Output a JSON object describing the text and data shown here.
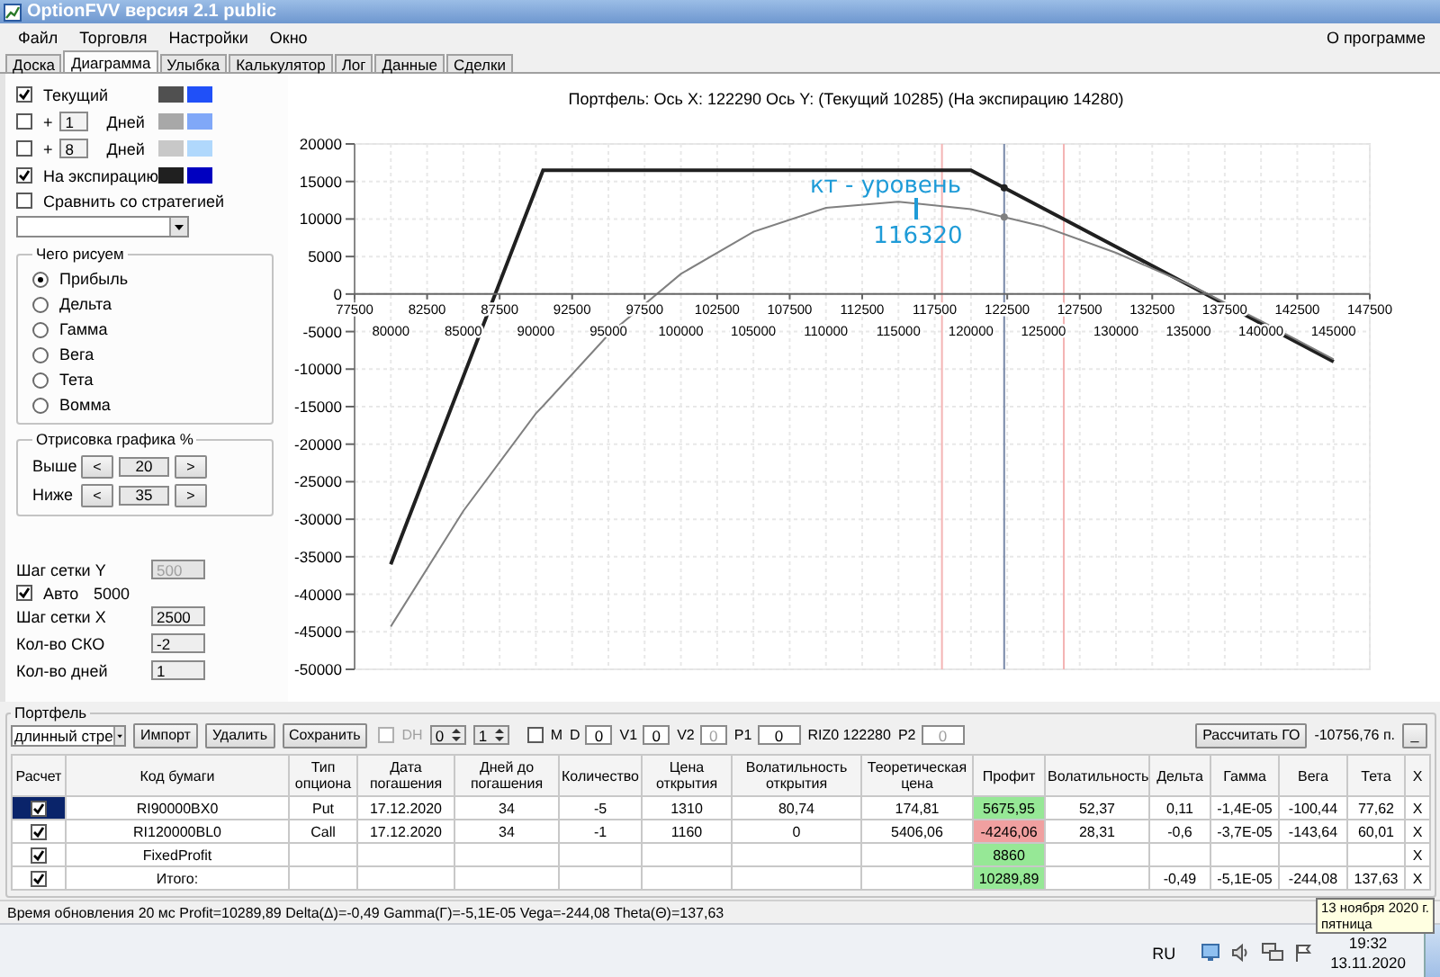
{
  "window": {
    "title": "OptionFVV версия 2.1 public"
  },
  "menu": [
    "Файл",
    "Торговля",
    "Настройки",
    "Окно"
  ],
  "menu_right": "О программе",
  "tabs": [
    {
      "label": "Доска",
      "selected": false
    },
    {
      "label": "Диаграмма",
      "selected": true
    },
    {
      "label": "Улыбка",
      "selected": false
    },
    {
      "label": "Калькулятор",
      "selected": false
    },
    {
      "label": "Лог",
      "selected": false
    },
    {
      "label": "Данные",
      "selected": false
    },
    {
      "label": "Сделки",
      "selected": false
    }
  ],
  "curves": [
    {
      "kind": "named",
      "label": "Текущий",
      "checked": true,
      "swatches": [
        {
          "color": "#505050"
        },
        {
          "color": "#2050f8"
        }
      ]
    },
    {
      "kind": "days",
      "prefix": "+",
      "value": "1",
      "unit": "Дней",
      "checked": false,
      "swatches": [
        {
          "color": "#a8a8a8"
        },
        {
          "color": "#80a8f8"
        }
      ]
    },
    {
      "kind": "days",
      "prefix": "+",
      "value": "8",
      "unit": "Дней",
      "checked": false,
      "swatches": [
        {
          "color": "#c8c8c8"
        },
        {
          "color": "#b0d8fc"
        }
      ]
    },
    {
      "kind": "named",
      "label": "На экспирацию",
      "checked": true,
      "swatches": [
        {
          "color": "#202020"
        },
        {
          "color": "#0000c0"
        }
      ]
    }
  ],
  "compare": {
    "label": "Сравнить со стратегией",
    "checked": false
  },
  "plot_kind": {
    "title": "Чего рисуем",
    "options": [
      {
        "label": "Прибыль",
        "selected": true
      },
      {
        "label": "Дельта",
        "selected": false
      },
      {
        "label": "Гамма",
        "selected": false
      },
      {
        "label": "Вега",
        "selected": false
      },
      {
        "label": "Тета",
        "selected": false
      },
      {
        "label": "Вомма",
        "selected": false
      }
    ]
  },
  "range": {
    "title": "Отрисовка графика %",
    "rows": [
      {
        "label": "Выше",
        "dec": "<",
        "value": "20",
        "inc": ">"
      },
      {
        "label": "Ниже",
        "dec": "<",
        "value": "35",
        "inc": ">"
      }
    ]
  },
  "grid": [
    {
      "kind": "field",
      "label": "Шаг сетки Y",
      "value": "500",
      "disabled": true
    },
    {
      "kind": "check",
      "label": "Авто",
      "checked": true,
      "value": "5000"
    },
    {
      "kind": "field",
      "label": "Шаг сетки X",
      "value": "2500",
      "disabled": false
    },
    {
      "kind": "field",
      "label": "Кол-во СКО",
      "value": "-2",
      "disabled": false
    },
    {
      "kind": "field",
      "label": "Кол-во дней",
      "value": "1",
      "disabled": false
    }
  ],
  "chart": {
    "title": "Портфель:  Ось X:  122290  Ось Y:   (Текущий  10285)   (На экспирацию  14280)",
    "x_labels_lower": [
      "80000",
      "85000",
      "90000",
      "95000",
      "100000",
      "105000",
      "110000",
      "115000",
      "120000",
      "125000",
      "130000",
      "135000",
      "140000",
      "145000"
    ],
    "chart_data": {
      "type": "line",
      "x": [
        80000,
        85000,
        90000,
        90500,
        95000,
        100000,
        105000,
        110000,
        115000,
        120000,
        125000,
        130000,
        135000,
        140000,
        145000
      ],
      "series": [
        {
          "color": "#202020",
          "values": [
            -36000,
            -11000,
            14000,
            16500,
            16500,
            16500,
            16500,
            16500,
            16500,
            16500,
            11400,
            6300,
            1200,
            -3900,
            -9000
          ]
        },
        {
          "color": "#808080",
          "values": [
            -44300,
            -28900,
            -15900,
            -14900,
            -5400,
            2700,
            8300,
            11500,
            12300,
            11300,
            9000,
            5500,
            1300,
            -3600,
            -8700
          ]
        }
      ],
      "xlim": [
        77500,
        147500
      ],
      "ylim": [
        -50000,
        20000
      ],
      "xticks": [
        77500,
        82500,
        87500,
        92500,
        97500,
        102500,
        107500,
        112500,
        117500,
        122500,
        127500,
        132500,
        137500,
        142500,
        147500
      ],
      "yticks": [
        -50000,
        -45000,
        -40000,
        -35000,
        -30000,
        -25000,
        -20000,
        -15000,
        -10000,
        -5000,
        0,
        5000,
        10000,
        15000,
        20000
      ],
      "grid": true,
      "ref_lines": [
        {
          "axis": "x",
          "value": 118000,
          "color": "#f4b4b4"
        },
        {
          "axis": "x",
          "value": 126400,
          "color": "#f4b4b4"
        },
        {
          "axis": "x",
          "value": 122290,
          "color": "#7888a8"
        }
      ],
      "annotations": [
        "кт - уровень",
        "116320"
      ]
    }
  },
  "portfolio": {
    "title": "Портфель",
    "strategy": "длинный стре",
    "buttons": [
      "Импорт",
      "Удалить",
      "Сохранить"
    ],
    "dh": {
      "label": "DH",
      "checked": false,
      "disabled": true
    },
    "spins": [
      "0",
      "1"
    ],
    "m": {
      "label": "M",
      "checked": false
    },
    "params": [
      {
        "kind": "field",
        "label": "D",
        "value": "0",
        "disabled": false
      },
      {
        "kind": "field",
        "label": "V1",
        "value": "0",
        "disabled": false
      },
      {
        "kind": "field",
        "label": "V2",
        "value": "0",
        "disabled": true
      },
      {
        "kind": "field",
        "label": "P1",
        "value": "0",
        "disabled": false
      },
      {
        "kind": "text",
        "text": "RIZ0 122280"
      },
      {
        "kind": "field",
        "label": "P2",
        "value": "0",
        "disabled": true
      }
    ],
    "calc_button": "Рассчитать ГО",
    "margin": "-10756,76 п.",
    "minimize": "_"
  },
  "table": {
    "columns": [
      "Расчет",
      "Код бумаги",
      "Тип опциона",
      "Дата погашения",
      "Дней до погашения",
      "Количество",
      "Цена открытия",
      "Волатильность открытия",
      "Теоретическая цена",
      "Профит",
      "Волатильность",
      "Дельта",
      "Гамма",
      "Вега",
      "Тета",
      "X"
    ],
    "rows": [
      {
        "selected": true,
        "checked": true,
        "color": "#96e896",
        "cells": [
          null,
          "RI90000BX0",
          "Put",
          "17.12.2020",
          "34",
          "-5",
          "1310",
          "80,74",
          "174,81",
          "5675,95",
          "52,37",
          "0,11",
          "-1,4E-05",
          "-100,44",
          "77,62",
          "X"
        ]
      },
      {
        "selected": false,
        "checked": true,
        "color": "#f0a0a0",
        "cells": [
          null,
          "RI120000BL0",
          "Call",
          "17.12.2020",
          "34",
          "-1",
          "1160",
          "0",
          "5406,06",
          "-4246,06",
          "28,31",
          "-0,6",
          "-3,7E-05",
          "-143,64",
          "60,01",
          "X"
        ]
      },
      {
        "selected": false,
        "checked": true,
        "color": "#96e896",
        "cells": [
          null,
          "FixedProfit",
          null,
          null,
          null,
          null,
          null,
          null,
          null,
          "8860",
          null,
          null,
          null,
          null,
          null,
          "X"
        ]
      },
      {
        "selected": false,
        "checked": true,
        "color": "#96e896",
        "cells": [
          null,
          "Итого:",
          null,
          null,
          null,
          null,
          null,
          null,
          null,
          "10289,89",
          null,
          "-0,49",
          "-5,1E-05",
          "-244,08",
          "137,63",
          "X"
        ]
      }
    ]
  },
  "status_bar": "Время обновления 20 мс   Profit=10289,89 Delta(Δ)=-0,49 Gamma(Γ)=-5,1E-05 Vega=-244,08 Theta(Θ)=137,63",
  "taskbar": {
    "lang": "RU",
    "time": "19:32",
    "date": "13.11.2020",
    "tooltip": [
      "13 ноября 2020 г.",
      "пятница"
    ]
  }
}
